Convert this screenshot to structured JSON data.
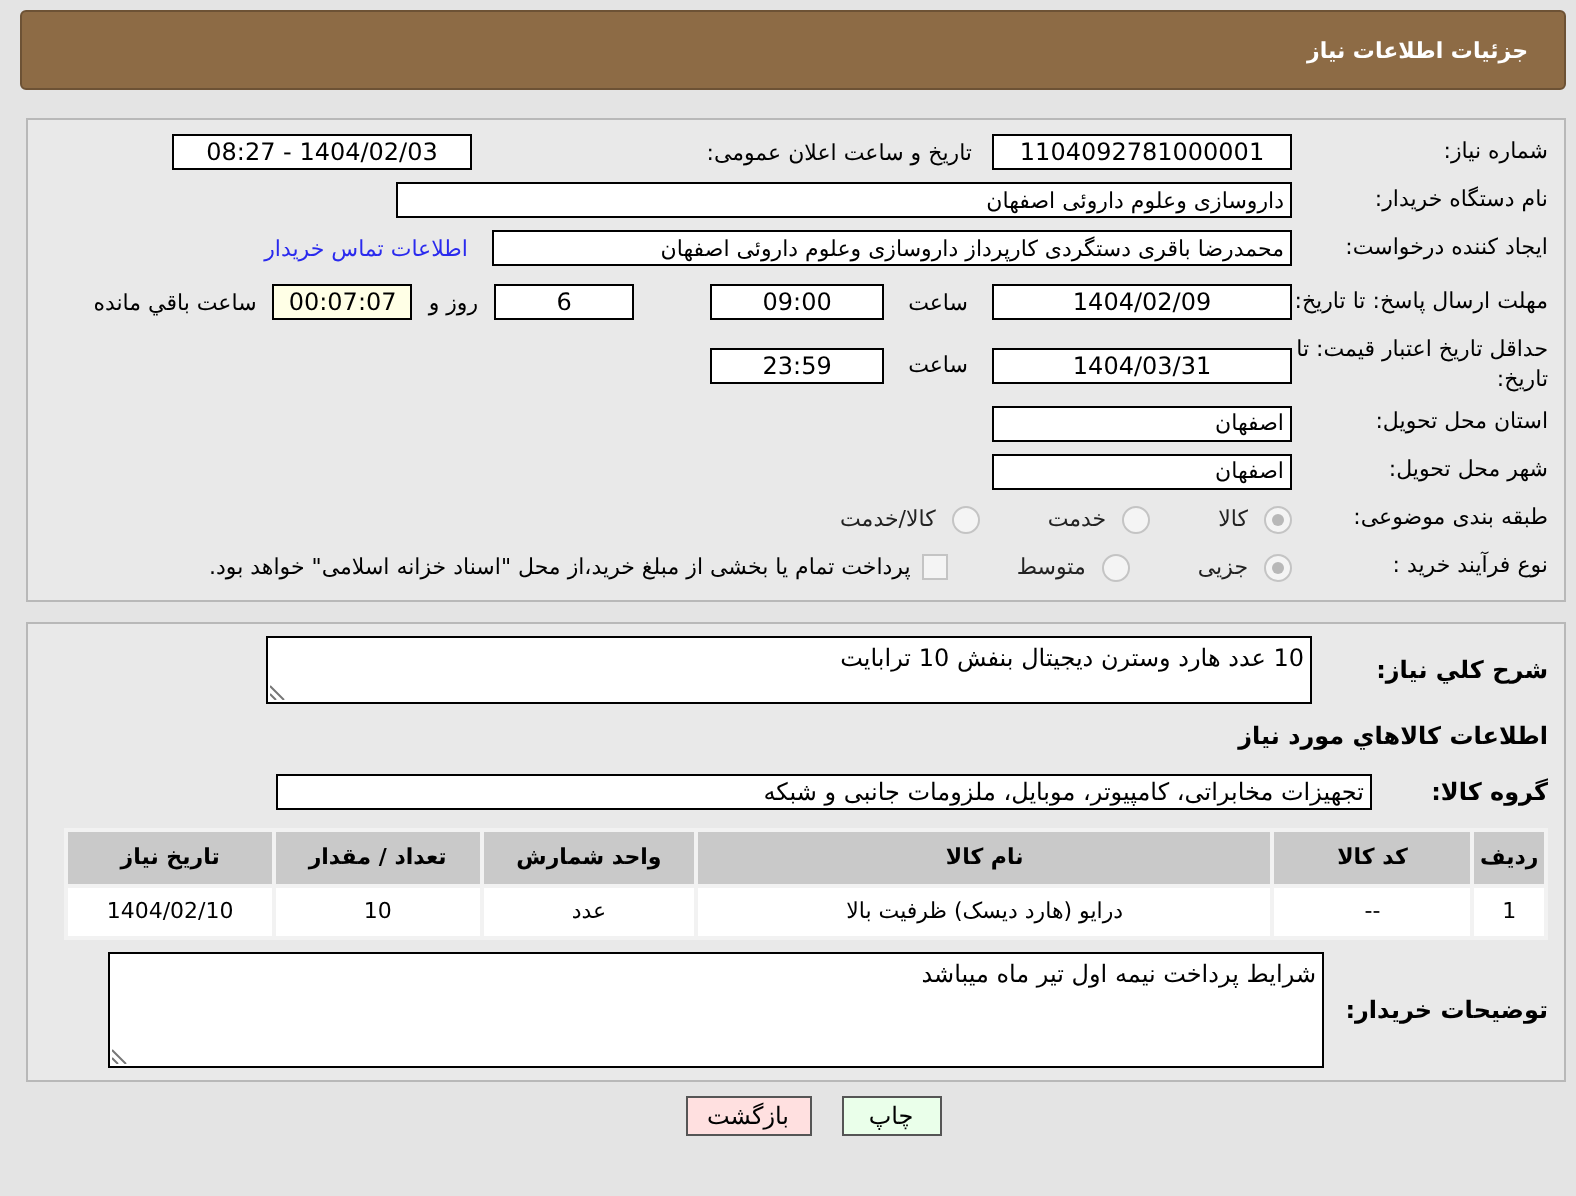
{
  "header": {
    "title": "جزئیات اطلاعات نیاز"
  },
  "need_info": {
    "need_number": {
      "label": "شماره نیاز:",
      "value": "1104092781000001"
    },
    "announce": {
      "label": "تاریخ و ساعت اعلان عمومی:",
      "value": "1404/02/03 - 08:27"
    },
    "buyer_org": {
      "label": "نام دستگاه خریدار:",
      "value": "داروسازی وعلوم داروئی اصفهان"
    },
    "requester": {
      "label": "ایجاد کننده درخواست:",
      "value": "محمدرضا باقری دستگردی کارپرداز داروسازی وعلوم داروئی اصفهان",
      "link": "اطلاعات تماس خریدار"
    },
    "deadline": {
      "label": "مهلت ارسال پاسخ: تا تاریخ:",
      "date": "1404/02/09",
      "time_label": "ساعت",
      "time": "09:00",
      "days": "6",
      "days_label": "روز و",
      "remaining": "00:07:07",
      "remaining_label": "ساعت باقي مانده"
    },
    "validity": {
      "label": "حداقل تاریخ اعتبار قیمت: تا تاریخ:",
      "date": "1404/03/31",
      "time_label": "ساعت",
      "time": "23:59"
    },
    "province": {
      "label": "استان محل تحویل:",
      "value": "اصفهان"
    },
    "city": {
      "label": "شهر محل تحویل:",
      "value": "اصفهان"
    },
    "category": {
      "label": "طبقه بندی موضوعی:",
      "options": [
        {
          "label": "کالا",
          "selected": true
        },
        {
          "label": "خدمت",
          "selected": false
        },
        {
          "label": "کالا/خدمت",
          "selected": false
        }
      ]
    },
    "process": {
      "label": "نوع فرآیند خرید :",
      "options": [
        {
          "label": "جزیی",
          "selected": true
        },
        {
          "label": "متوسط",
          "selected": false
        }
      ],
      "payment": {
        "label": "پرداخت تمام یا بخشی از مبلغ خرید،از محل \"اسناد خزانه اسلامی\" خواهد بود.",
        "checked": false
      }
    }
  },
  "description": {
    "label": "شرح کلي نیاز:",
    "value": "10 عدد هارد وسترن دیجیتال بنفش 10 ترابایت"
  },
  "goods_title": "اطلاعات کالاهاي مورد نیاز",
  "group": {
    "label": "گروه کالا:",
    "value": "تجهیزات مخابراتی، کامپیوتر، موبایل، ملزومات جانبی و شبکه"
  },
  "table": {
    "columns": [
      "ردیف",
      "کد کالا",
      "نام کالا",
      "واحد شمارش",
      "تعداد / مقدار",
      "تاریخ نیاز"
    ],
    "rows": [
      [
        "1",
        "--",
        "درایو (هارد دیسک) ظرفیت بالا",
        "عدد",
        "10",
        "1404/02/10"
      ]
    ]
  },
  "buyer_notes": {
    "label": "توضیحات خریدار:",
    "value": "شرایط پرداخت نیمه اول تیر ماه میباشد"
  },
  "buttons": [
    {
      "label": "چاپ",
      "kind": "print"
    },
    {
      "label": "بازگشت",
      "kind": "back"
    }
  ]
}
